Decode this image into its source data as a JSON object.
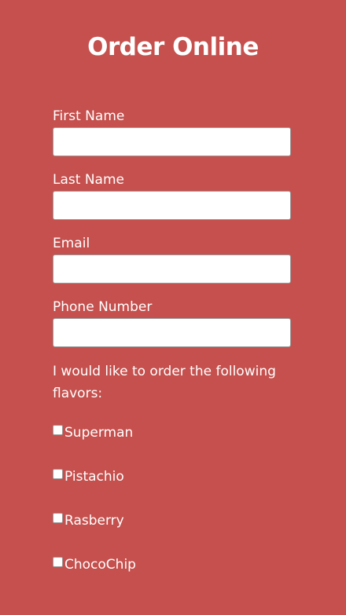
{
  "page": {
    "title": "Order Online"
  },
  "form": {
    "fields": [
      {
        "label": "First Name",
        "value": "",
        "placeholder": ""
      },
      {
        "label": "Last Name",
        "value": "",
        "placeholder": ""
      },
      {
        "label": "Email",
        "value": "",
        "placeholder": ""
      },
      {
        "label": "Phone Number",
        "value": "",
        "placeholder": ""
      }
    ],
    "flavors_prompt": "I would like to order the following flavors:",
    "flavors": [
      {
        "label": "Superman",
        "checked": false
      },
      {
        "label": "Pistachio",
        "checked": false
      },
      {
        "label": "Rasberry",
        "checked": false
      },
      {
        "label": "ChocoChip",
        "checked": false
      }
    ]
  },
  "colors": {
    "background": "#c5504d",
    "text": "#ffffff",
    "input_background": "#ffffff"
  }
}
